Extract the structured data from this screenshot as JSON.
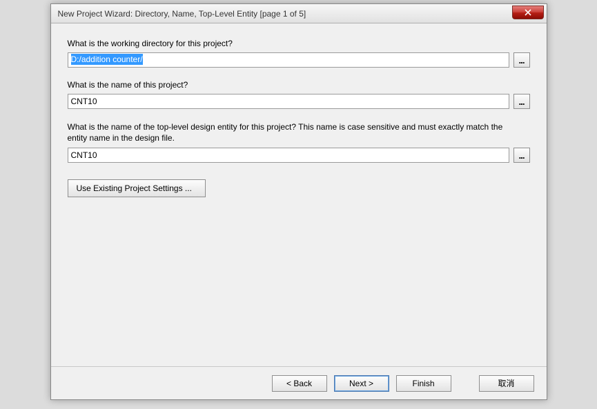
{
  "window": {
    "title": "New Project Wizard: Directory, Name, Top-Level Entity [page 1 of 5]"
  },
  "fields": {
    "directory": {
      "label": "What is the working directory for this project?",
      "value": "D:/addition counter/",
      "browse": "..."
    },
    "project_name": {
      "label": "What is the name of this project?",
      "value": "CNT10",
      "browse": "..."
    },
    "top_entity": {
      "label": "What is the name of the top-level design entity for this project? This name is case sensitive and must exactly match the entity name in the design file.",
      "value": "CNT10",
      "browse": "..."
    }
  },
  "buttons": {
    "use_existing": "Use Existing Project Settings ...",
    "back": "< Back",
    "next": "Next >",
    "finish": "Finish",
    "cancel": "取消"
  }
}
